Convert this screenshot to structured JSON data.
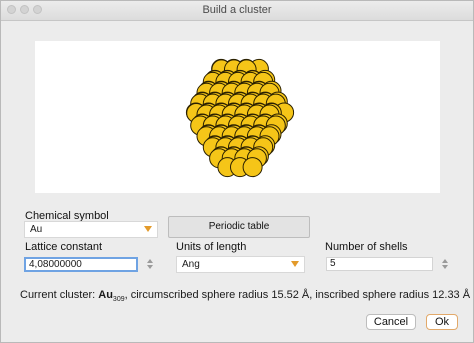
{
  "window": {
    "title": "Build a cluster"
  },
  "chemical_symbol": {
    "label": "Chemical symbol",
    "value": "Au"
  },
  "periodic_table_button": "Periodic table",
  "lattice_constant": {
    "label": "Lattice constant",
    "value": "4,08000000"
  },
  "units_of_length": {
    "label": "Units of length",
    "value": "Ang"
  },
  "number_of_shells": {
    "label": "Number of shells",
    "value": "5"
  },
  "status": {
    "prefix": "Current cluster: ",
    "element": "Au",
    "atom_count": "309",
    "suffix": ", circumscribed sphere radius 15.52 Å, inscribed sphere radius 12.33 Å"
  },
  "buttons": {
    "cancel": "Cancel",
    "ok": "Ok"
  },
  "colors": {
    "atom_fill": "#f5c518",
    "atom_stroke": "#2a2000",
    "accent": "#e39a2a",
    "focus": "#6fa3e3"
  }
}
